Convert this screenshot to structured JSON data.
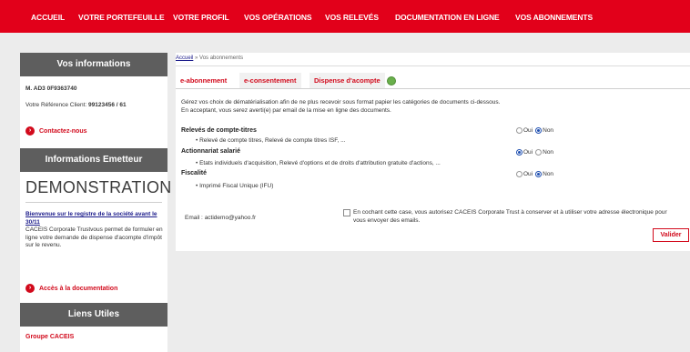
{
  "nav": {
    "items": [
      "ACCUEIL",
      "VOTRE PORTEFEUILLE",
      "VOTRE PROFIL",
      "VOS OPÉRATIONS",
      "VOS RELEVÉS",
      "DOCUMENTATION EN LIGNE",
      "VOS ABONNEMENTS"
    ]
  },
  "sidebar": {
    "info_title": "Vos informations",
    "user_line": "M. AD3 0F9363740",
    "reference_label": "Votre Référence Client:",
    "reference_value": "99123456 / 61",
    "contact_label": "Contactez-nous",
    "emitter_title": "Informations Emetteur",
    "logo_text": "DEMONSTRATION",
    "welcome_link": "Bienvenue sur le registre de la société avant le 30/11",
    "welcome_text": "CACEIS Corporate Trustvous permet de formuler en ligne votre demande de dispense d'acompte d'impôt sur le revenu.",
    "doc_link": "Accès à la documentation",
    "links_title": "Liens Utiles",
    "groupe_link": "Groupe CACEIS"
  },
  "main": {
    "breadcrumb_home": "Accueil",
    "breadcrumb_sep": "»",
    "breadcrumb_current": "Vos abonnements",
    "tabs": [
      "e-abonnement",
      "e-consentement",
      "Dispense d'acompte"
    ],
    "intro_line1": "Gérez vos choix de dématérialisation afin de ne plus recevoir sous format papier les catégories de documents ci-dessous.",
    "intro_line2": "En acceptant, vous serez averti(e) par email de la mise en ligne des documents.",
    "sections": [
      {
        "title": "Relevés de compte-titres",
        "item": "Relevé de compte titres, Relevé de compte titres ISF, ...",
        "oui": "Oui",
        "non": "Non",
        "selected": "Non"
      },
      {
        "title": "Actionnariat salarié",
        "item": "Etats individuels d'acquisition, Relevé d'options et de droits d'attribution gratuite d'actions, ...",
        "oui": "Oui",
        "non": "Non",
        "selected": "Oui"
      },
      {
        "title": "Fiscalité",
        "item": "Imprimé Fiscal Unique (IFU)",
        "oui": "Oui",
        "non": "Non",
        "selected": "Non"
      }
    ],
    "email_label": "Email :",
    "email_value": "actidemo@yahoo.fr",
    "consent_text": "En cochant cette case, vous autorisez CACEIS Corporate Trust à conserver et à utiliser votre adresse électronique pour vous envoyer des emails.",
    "submit_label": "Valider"
  },
  "colors": {
    "brand_red": "#e2001a",
    "panel_gray": "#5e5e5e",
    "page_bg": "#ececec"
  }
}
